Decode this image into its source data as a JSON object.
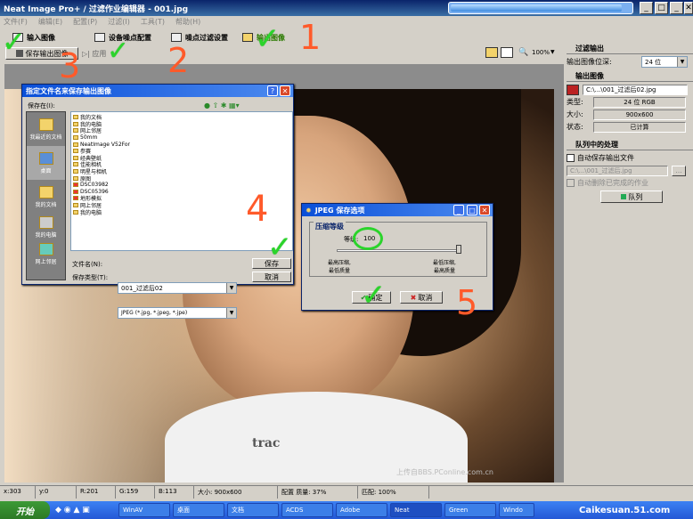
{
  "window": {
    "title": "Neat Image Pro+ / 过滤作业编辑器 - 001.jpg",
    "progress_fraction": 0.95
  },
  "menu": [
    "文件(F)",
    "编辑(E)",
    "配置(P)",
    "过滤(I)",
    "工具(T)",
    "帮助(H)"
  ],
  "toolbar": {
    "input_image": "输入图像",
    "device_noise": "设备噪点配置",
    "noise_filter": "噪点过滤设置",
    "output_image": "输出图像",
    "save_output": "保存输出图像",
    "apply": "应用",
    "zoom": "100%"
  },
  "annotations": {
    "n1": "1",
    "n2": "2",
    "n3": "3",
    "n4": "4",
    "n5": "5"
  },
  "photo": {
    "shirt_text": "trac",
    "watermark": "上传自BBS.PConline.com.cn"
  },
  "save_dialog": {
    "title": "指定文件名来保存输出图像",
    "save_in_label": "保存在(I):",
    "save_in_value": "桌面",
    "places": [
      "我最近的文档",
      "桌面",
      "我的文档",
      "我的电脑",
      "网上邻居"
    ],
    "files": [
      "我的文档",
      "我的电脑",
      "网上邻居",
      "50mm",
      "NeatImage V52For",
      "参赛",
      "经典壁纸",
      "佳能相机",
      "明星与相机",
      "原图",
      "DSC03982",
      "DSC05396",
      "地形模拟",
      "网上邻居",
      "我的电脑"
    ],
    "filename_label": "文件名(N):",
    "filename_value": "001_过滤后02",
    "filetype_label": "保存类型(T):",
    "filetype_value": "JPEG (*.jpg, *.jpeg, *.jpe)",
    "save_btn": "保存",
    "cancel_btn": "取消"
  },
  "jpeg_dialog": {
    "title": "JPEG 保存选项",
    "group_label": "压缩等级",
    "quality_label": "等级:",
    "quality_value": "100",
    "left_label_1": "最高压缩,",
    "left_label_2": "最低质量",
    "right_label_1": "最低压缩,",
    "right_label_2": "最高质量",
    "ok_btn": "确定",
    "cancel_btn": "取消"
  },
  "right_panel": {
    "filter_output_title": "过滤输出",
    "bit_depth_label": "输出图像位深:",
    "bit_depth_value": "24 位",
    "output_image_title": "输出图像",
    "output_path": "C:\\...\\001_过滤后02.jpg",
    "type_label": "类型:",
    "type_value": "24 位 RGB",
    "size_label": "大小:",
    "size_value": "900x600",
    "status_label": "状态:",
    "status_value": "已计算",
    "queue_title": "队列中的处理",
    "auto_save_label": "自动保存输出文件",
    "auto_save_path": "C:\\...\\001_过滤后.jpg",
    "auto_remove_label": "自动删除已完成的作业",
    "queue_btn": "队列"
  },
  "status_bar": {
    "x": "x:303",
    "y": "y:0",
    "r": "R:201",
    "g": "G:159",
    "b": "B:113",
    "size": "大小: 900x600",
    "config": "配置 质量: 37%",
    "match": "匹配: 100%"
  },
  "taskbar": {
    "start": "开始",
    "tasks": [
      "WinAV",
      "桌面",
      "文档",
      "ACDS",
      "Adobe",
      "Neat",
      "Green",
      "Windo"
    ],
    "site": "Caikesuan.51.com"
  }
}
